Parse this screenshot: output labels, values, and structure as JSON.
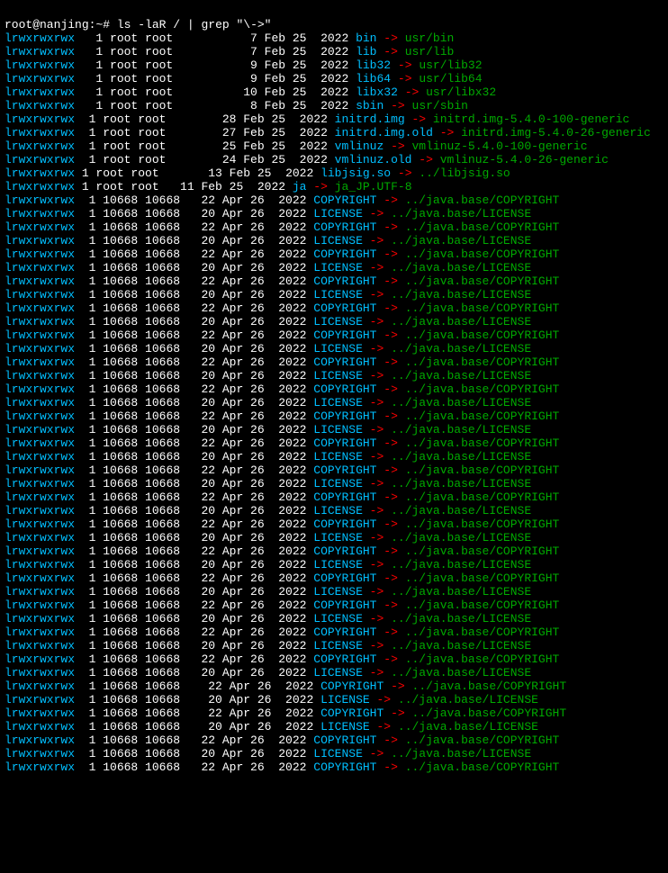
{
  "prompt": {
    "user": "root@nanjing",
    "separator": ":",
    "path": "~",
    "symbol": "# ",
    "command": "ls -laR / | grep \"\\->\""
  },
  "lines": [
    {
      "perms": "lrwxrwxrwx",
      "sp": "   ",
      "rest": "1 root root           7 Feb 25  2022 ",
      "name": "bin",
      "target": "usr/bin"
    },
    {
      "perms": "lrwxrwxrwx",
      "sp": "   ",
      "rest": "1 root root           7 Feb 25  2022 ",
      "name": "lib",
      "target": "usr/lib"
    },
    {
      "perms": "lrwxrwxrwx",
      "sp": "   ",
      "rest": "1 root root           9 Feb 25  2022 ",
      "name": "lib32",
      "target": "usr/lib32"
    },
    {
      "perms": "lrwxrwxrwx",
      "sp": "   ",
      "rest": "1 root root           9 Feb 25  2022 ",
      "name": "lib64",
      "target": "usr/lib64"
    },
    {
      "perms": "lrwxrwxrwx",
      "sp": "   ",
      "rest": "1 root root          10 Feb 25  2022 ",
      "name": "libx32",
      "target": "usr/libx32"
    },
    {
      "perms": "lrwxrwxrwx",
      "sp": "   ",
      "rest": "1 root root           8 Feb 25  2022 ",
      "name": "sbin",
      "target": "usr/sbin"
    },
    {
      "perms": "lrwxrwxrwx",
      "sp": "  ",
      "rest": "1 root root        28 Feb 25  2022 ",
      "name": "initrd.img",
      "target": "initrd.img-5.4.0-100-generic"
    },
    {
      "perms": "lrwxrwxrwx",
      "sp": "  ",
      "rest": "1 root root        27 Feb 25  2022 ",
      "name": "initrd.img.old",
      "target": "initrd.img-5.4.0-26-generic"
    },
    {
      "perms": "lrwxrwxrwx",
      "sp": "  ",
      "rest": "1 root root        25 Feb 25  2022 ",
      "name": "vmlinuz",
      "target": "vmlinuz-5.4.0-100-generic"
    },
    {
      "perms": "lrwxrwxrwx",
      "sp": "  ",
      "rest": "1 root root        24 Feb 25  2022 ",
      "name": "vmlinuz.old",
      "target": "vmlinuz-5.4.0-26-generic"
    },
    {
      "perms": "lrwxrwxrwx",
      "sp": " ",
      "rest": "1 root root       13 Feb 25  2022 ",
      "name": "libjsig.so",
      "target": "../libjsig.so"
    },
    {
      "perms": "lrwxrwxrwx",
      "sp": " ",
      "rest": "1 root root   11 Feb 25  2022 ",
      "name": "ja",
      "target": "ja_JP.UTF-8"
    },
    {
      "perms": "lrwxrwxrwx",
      "sp": "  ",
      "rest": "1 10668 10668   22 Apr 26  2022 ",
      "name": "COPYRIGHT",
      "target": "../java.base/COPYRIGHT"
    },
    {
      "perms": "lrwxrwxrwx",
      "sp": "  ",
      "rest": "1 10668 10668   20 Apr 26  2022 ",
      "name": "LICENSE",
      "target": "../java.base/LICENSE"
    },
    {
      "perms": "lrwxrwxrwx",
      "sp": "  ",
      "rest": "1 10668 10668   22 Apr 26  2022 ",
      "name": "COPYRIGHT",
      "target": "../java.base/COPYRIGHT"
    },
    {
      "perms": "lrwxrwxrwx",
      "sp": "  ",
      "rest": "1 10668 10668   20 Apr 26  2022 ",
      "name": "LICENSE",
      "target": "../java.base/LICENSE"
    },
    {
      "perms": "lrwxrwxrwx",
      "sp": "  ",
      "rest": "1 10668 10668   22 Apr 26  2022 ",
      "name": "COPYRIGHT",
      "target": "../java.base/COPYRIGHT"
    },
    {
      "perms": "lrwxrwxrwx",
      "sp": "  ",
      "rest": "1 10668 10668   20 Apr 26  2022 ",
      "name": "LICENSE",
      "target": "../java.base/LICENSE"
    },
    {
      "perms": "lrwxrwxrwx",
      "sp": "  ",
      "rest": "1 10668 10668   22 Apr 26  2022 ",
      "name": "COPYRIGHT",
      "target": "../java.base/COPYRIGHT"
    },
    {
      "perms": "lrwxrwxrwx",
      "sp": "  ",
      "rest": "1 10668 10668   20 Apr 26  2022 ",
      "name": "LICENSE",
      "target": "../java.base/LICENSE"
    },
    {
      "perms": "lrwxrwxrwx",
      "sp": "  ",
      "rest": "1 10668 10668   22 Apr 26  2022 ",
      "name": "COPYRIGHT",
      "target": "../java.base/COPYRIGHT"
    },
    {
      "perms": "lrwxrwxrwx",
      "sp": "  ",
      "rest": "1 10668 10668   20 Apr 26  2022 ",
      "name": "LICENSE",
      "target": "../java.base/LICENSE"
    },
    {
      "perms": "lrwxrwxrwx",
      "sp": "  ",
      "rest": "1 10668 10668   22 Apr 26  2022 ",
      "name": "COPYRIGHT",
      "target": "../java.base/COPYRIGHT"
    },
    {
      "perms": "lrwxrwxrwx",
      "sp": "  ",
      "rest": "1 10668 10668   20 Apr 26  2022 ",
      "name": "LICENSE",
      "target": "../java.base/LICENSE"
    },
    {
      "perms": "lrwxrwxrwx",
      "sp": "  ",
      "rest": "1 10668 10668   22 Apr 26  2022 ",
      "name": "COPYRIGHT",
      "target": "../java.base/COPYRIGHT"
    },
    {
      "perms": "lrwxrwxrwx",
      "sp": "  ",
      "rest": "1 10668 10668   20 Apr 26  2022 ",
      "name": "LICENSE",
      "target": "../java.base/LICENSE"
    },
    {
      "perms": "lrwxrwxrwx",
      "sp": "  ",
      "rest": "1 10668 10668   22 Apr 26  2022 ",
      "name": "COPYRIGHT",
      "target": "../java.base/COPYRIGHT"
    },
    {
      "perms": "lrwxrwxrwx",
      "sp": "  ",
      "rest": "1 10668 10668   20 Apr 26  2022 ",
      "name": "LICENSE",
      "target": "../java.base/LICENSE"
    },
    {
      "perms": "lrwxrwxrwx",
      "sp": "  ",
      "rest": "1 10668 10668   22 Apr 26  2022 ",
      "name": "COPYRIGHT",
      "target": "../java.base/COPYRIGHT"
    },
    {
      "perms": "lrwxrwxrwx",
      "sp": "  ",
      "rest": "1 10668 10668   20 Apr 26  2022 ",
      "name": "LICENSE",
      "target": "../java.base/LICENSE"
    },
    {
      "perms": "lrwxrwxrwx",
      "sp": "  ",
      "rest": "1 10668 10668   22 Apr 26  2022 ",
      "name": "COPYRIGHT",
      "target": "../java.base/COPYRIGHT"
    },
    {
      "perms": "lrwxrwxrwx",
      "sp": "  ",
      "rest": "1 10668 10668   20 Apr 26  2022 ",
      "name": "LICENSE",
      "target": "../java.base/LICENSE"
    },
    {
      "perms": "lrwxrwxrwx",
      "sp": "  ",
      "rest": "1 10668 10668   22 Apr 26  2022 ",
      "name": "COPYRIGHT",
      "target": "../java.base/COPYRIGHT"
    },
    {
      "perms": "lrwxrwxrwx",
      "sp": "  ",
      "rest": "1 10668 10668   20 Apr 26  2022 ",
      "name": "LICENSE",
      "target": "../java.base/LICENSE"
    },
    {
      "perms": "lrwxrwxrwx",
      "sp": "  ",
      "rest": "1 10668 10668   22 Apr 26  2022 ",
      "name": "COPYRIGHT",
      "target": "../java.base/COPYRIGHT"
    },
    {
      "perms": "lrwxrwxrwx",
      "sp": "  ",
      "rest": "1 10668 10668   20 Apr 26  2022 ",
      "name": "LICENSE",
      "target": "../java.base/LICENSE"
    },
    {
      "perms": "lrwxrwxrwx",
      "sp": "  ",
      "rest": "1 10668 10668   22 Apr 26  2022 ",
      "name": "COPYRIGHT",
      "target": "../java.base/COPYRIGHT"
    },
    {
      "perms": "lrwxrwxrwx",
      "sp": "  ",
      "rest": "1 10668 10668   20 Apr 26  2022 ",
      "name": "LICENSE",
      "target": "../java.base/LICENSE"
    },
    {
      "perms": "lrwxrwxrwx",
      "sp": "  ",
      "rest": "1 10668 10668   22 Apr 26  2022 ",
      "name": "COPYRIGHT",
      "target": "../java.base/COPYRIGHT"
    },
    {
      "perms": "lrwxrwxrwx",
      "sp": "  ",
      "rest": "1 10668 10668   20 Apr 26  2022 ",
      "name": "LICENSE",
      "target": "../java.base/LICENSE"
    },
    {
      "perms": "lrwxrwxrwx",
      "sp": "  ",
      "rest": "1 10668 10668   22 Apr 26  2022 ",
      "name": "COPYRIGHT",
      "target": "../java.base/COPYRIGHT"
    },
    {
      "perms": "lrwxrwxrwx",
      "sp": "  ",
      "rest": "1 10668 10668   20 Apr 26  2022 ",
      "name": "LICENSE",
      "target": "../java.base/LICENSE"
    },
    {
      "perms": "lrwxrwxrwx",
      "sp": "  ",
      "rest": "1 10668 10668   22 Apr 26  2022 ",
      "name": "COPYRIGHT",
      "target": "../java.base/COPYRIGHT"
    },
    {
      "perms": "lrwxrwxrwx",
      "sp": "  ",
      "rest": "1 10668 10668   20 Apr 26  2022 ",
      "name": "LICENSE",
      "target": "../java.base/LICENSE"
    },
    {
      "perms": "lrwxrwxrwx",
      "sp": "  ",
      "rest": "1 10668 10668   22 Apr 26  2022 ",
      "name": "COPYRIGHT",
      "target": "../java.base/COPYRIGHT"
    },
    {
      "perms": "lrwxrwxrwx",
      "sp": "  ",
      "rest": "1 10668 10668   20 Apr 26  2022 ",
      "name": "LICENSE",
      "target": "../java.base/LICENSE"
    },
    {
      "perms": "lrwxrwxrwx",
      "sp": "  ",
      "rest": "1 10668 10668   22 Apr 26  2022 ",
      "name": "COPYRIGHT",
      "target": "../java.base/COPYRIGHT"
    },
    {
      "perms": "lrwxrwxrwx",
      "sp": "  ",
      "rest": "1 10668 10668   20 Apr 26  2022 ",
      "name": "LICENSE",
      "target": "../java.base/LICENSE"
    },
    {
      "perms": "lrwxrwxrwx",
      "sp": "  ",
      "rest": "1 10668 10668    22 Apr 26  2022 ",
      "name": "COPYRIGHT",
      "target": "../java.base/COPYRIGHT"
    },
    {
      "perms": "lrwxrwxrwx",
      "sp": "  ",
      "rest": "1 10668 10668    20 Apr 26  2022 ",
      "name": "LICENSE",
      "target": "../java.base/LICENSE"
    },
    {
      "perms": "lrwxrwxrwx",
      "sp": "  ",
      "rest": "1 10668 10668    22 Apr 26  2022 ",
      "name": "COPYRIGHT",
      "target": "../java.base/COPYRIGHT"
    },
    {
      "perms": "lrwxrwxrwx",
      "sp": "  ",
      "rest": "1 10668 10668    20 Apr 26  2022 ",
      "name": "LICENSE",
      "target": "../java.base/LICENSE"
    },
    {
      "perms": "lrwxrwxrwx",
      "sp": "  ",
      "rest": "1 10668 10668   22 Apr 26  2022 ",
      "name": "COPYRIGHT",
      "target": "../java.base/COPYRIGHT"
    },
    {
      "perms": "lrwxrwxrwx",
      "sp": "  ",
      "rest": "1 10668 10668   20 Apr 26  2022 ",
      "name": "LICENSE",
      "target": "../java.base/LICENSE"
    },
    {
      "perms": "lrwxrwxrwx",
      "sp": "  ",
      "rest": "1 10668 10668   22 Apr 26  2022 ",
      "name": "COPYRIGHT",
      "target": "../java.base/COPYRIGHT"
    }
  ]
}
